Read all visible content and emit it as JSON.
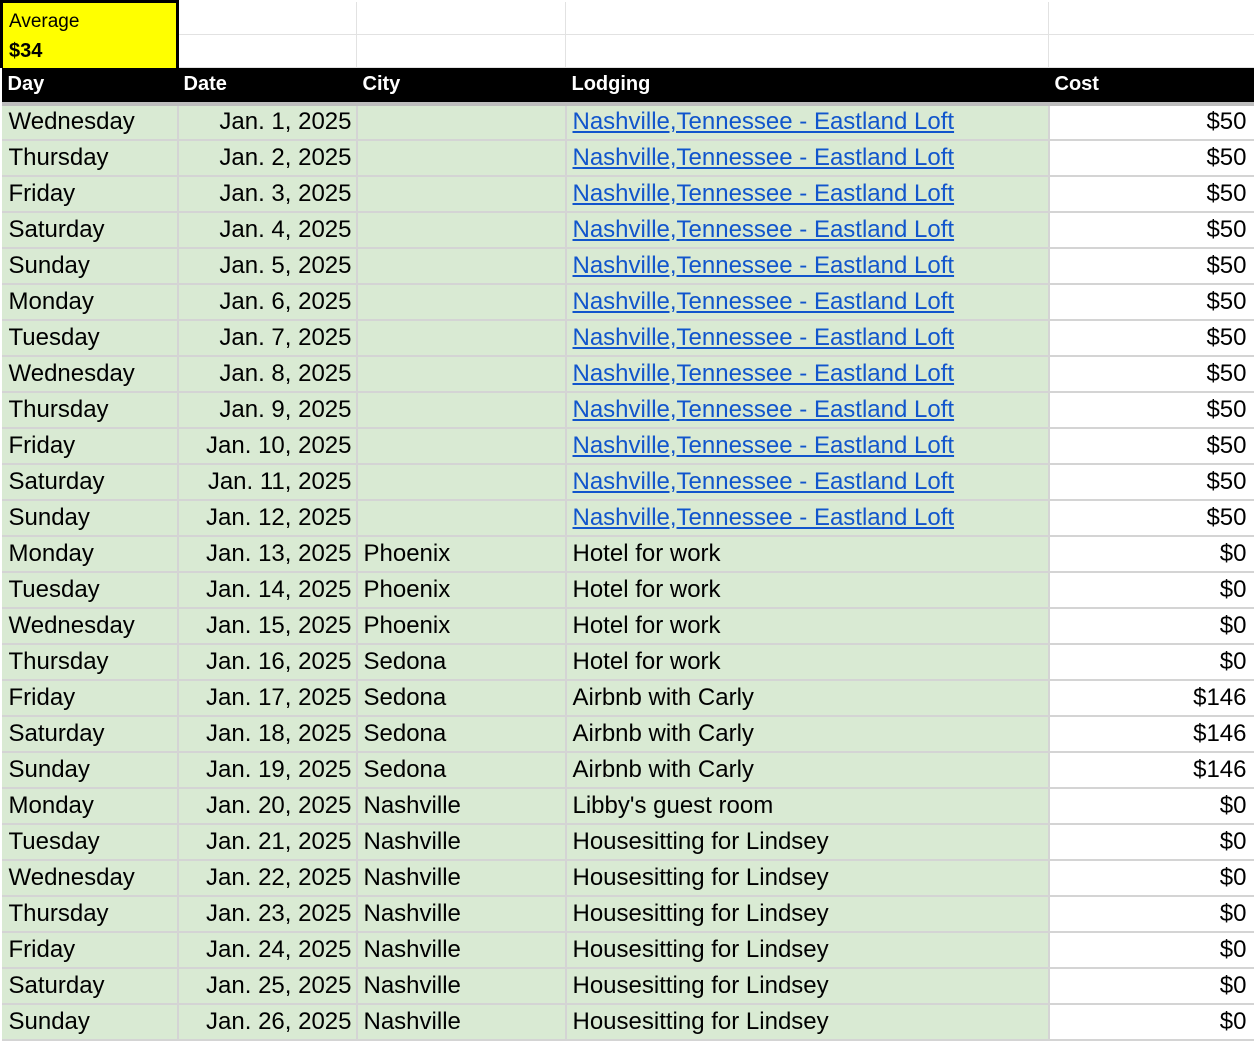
{
  "summary": {
    "average_label": "Average",
    "average_value": "$34",
    "highlight_color": "#ffff00"
  },
  "header": {
    "day": "Day",
    "date": "Date",
    "city": "City",
    "lodging": "Lodging",
    "cost": "Cost"
  },
  "colors": {
    "row_fill": "#d9ead3",
    "header_bg": "#000000",
    "link": "#1155cc"
  },
  "rows": [
    {
      "day": "Wednesday",
      "date": "Jan. 1, 2025",
      "city": "",
      "lodging": "Nashville,Tennessee - Eastland Loft",
      "lodging_is_link": true,
      "cost": "$50"
    },
    {
      "day": "Thursday",
      "date": "Jan. 2, 2025",
      "city": "",
      "lodging": "Nashville,Tennessee - Eastland Loft",
      "lodging_is_link": true,
      "cost": "$50"
    },
    {
      "day": "Friday",
      "date": "Jan. 3, 2025",
      "city": "",
      "lodging": "Nashville,Tennessee - Eastland Loft",
      "lodging_is_link": true,
      "cost": "$50"
    },
    {
      "day": "Saturday",
      "date": "Jan. 4, 2025",
      "city": "",
      "lodging": "Nashville,Tennessee - Eastland Loft",
      "lodging_is_link": true,
      "cost": "$50"
    },
    {
      "day": "Sunday",
      "date": "Jan. 5, 2025",
      "city": "",
      "lodging": "Nashville,Tennessee - Eastland Loft",
      "lodging_is_link": true,
      "cost": "$50"
    },
    {
      "day": "Monday",
      "date": "Jan. 6, 2025",
      "city": "",
      "lodging": "Nashville,Tennessee - Eastland Loft",
      "lodging_is_link": true,
      "cost": "$50"
    },
    {
      "day": "Tuesday",
      "date": "Jan. 7, 2025",
      "city": "",
      "lodging": "Nashville,Tennessee - Eastland Loft",
      "lodging_is_link": true,
      "cost": "$50"
    },
    {
      "day": "Wednesday",
      "date": "Jan. 8, 2025",
      "city": "",
      "lodging": "Nashville,Tennessee - Eastland Loft",
      "lodging_is_link": true,
      "cost": "$50"
    },
    {
      "day": "Thursday",
      "date": "Jan. 9, 2025",
      "city": "",
      "lodging": "Nashville,Tennessee - Eastland Loft",
      "lodging_is_link": true,
      "cost": "$50"
    },
    {
      "day": "Friday",
      "date": "Jan. 10, 2025",
      "city": "",
      "lodging": "Nashville,Tennessee - Eastland Loft",
      "lodging_is_link": true,
      "cost": "$50"
    },
    {
      "day": "Saturday",
      "date": "Jan. 11, 2025",
      "city": "",
      "lodging": "Nashville,Tennessee - Eastland Loft",
      "lodging_is_link": true,
      "cost": "$50"
    },
    {
      "day": "Sunday",
      "date": "Jan. 12, 2025",
      "city": "",
      "lodging": "Nashville,Tennessee - Eastland Loft",
      "lodging_is_link": true,
      "cost": "$50"
    },
    {
      "day": "Monday",
      "date": "Jan. 13, 2025",
      "city": "Phoenix",
      "lodging": "Hotel for work",
      "lodging_is_link": false,
      "cost": "$0"
    },
    {
      "day": "Tuesday",
      "date": "Jan. 14, 2025",
      "city": "Phoenix",
      "lodging": "Hotel for work",
      "lodging_is_link": false,
      "cost": "$0"
    },
    {
      "day": "Wednesday",
      "date": "Jan. 15, 2025",
      "city": "Phoenix",
      "lodging": "Hotel for work",
      "lodging_is_link": false,
      "cost": "$0"
    },
    {
      "day": "Thursday",
      "date": "Jan. 16, 2025",
      "city": "Sedona",
      "lodging": "Hotel for work",
      "lodging_is_link": false,
      "cost": "$0"
    },
    {
      "day": "Friday",
      "date": "Jan. 17, 2025",
      "city": "Sedona",
      "lodging": "Airbnb with Carly",
      "lodging_is_link": false,
      "cost": "$146"
    },
    {
      "day": "Saturday",
      "date": "Jan. 18, 2025",
      "city": "Sedona",
      "lodging": "Airbnb with Carly",
      "lodging_is_link": false,
      "cost": "$146"
    },
    {
      "day": "Sunday",
      "date": "Jan. 19, 2025",
      "city": "Sedona",
      "lodging": "Airbnb with Carly",
      "lodging_is_link": false,
      "cost": "$146"
    },
    {
      "day": "Monday",
      "date": "Jan. 20, 2025",
      "city": "Nashville",
      "lodging": "Libby's guest room",
      "lodging_is_link": false,
      "cost": "$0"
    },
    {
      "day": "Tuesday",
      "date": "Jan. 21, 2025",
      "city": "Nashville",
      "lodging": "Housesitting for Lindsey",
      "lodging_is_link": false,
      "cost": "$0"
    },
    {
      "day": "Wednesday",
      "date": "Jan. 22, 2025",
      "city": "Nashville",
      "lodging": "Housesitting for Lindsey",
      "lodging_is_link": false,
      "cost": "$0"
    },
    {
      "day": "Thursday",
      "date": "Jan. 23, 2025",
      "city": "Nashville",
      "lodging": "Housesitting for Lindsey",
      "lodging_is_link": false,
      "cost": "$0"
    },
    {
      "day": "Friday",
      "date": "Jan. 24, 2025",
      "city": "Nashville",
      "lodging": "Housesitting for Lindsey",
      "lodging_is_link": false,
      "cost": "$0"
    },
    {
      "day": "Saturday",
      "date": "Jan. 25, 2025",
      "city": "Nashville",
      "lodging": "Housesitting for Lindsey",
      "lodging_is_link": false,
      "cost": "$0"
    },
    {
      "day": "Sunday",
      "date": "Jan. 26, 2025",
      "city": "Nashville",
      "lodging": "Housesitting for Lindsey",
      "lodging_is_link": false,
      "cost": "$0"
    }
  ]
}
